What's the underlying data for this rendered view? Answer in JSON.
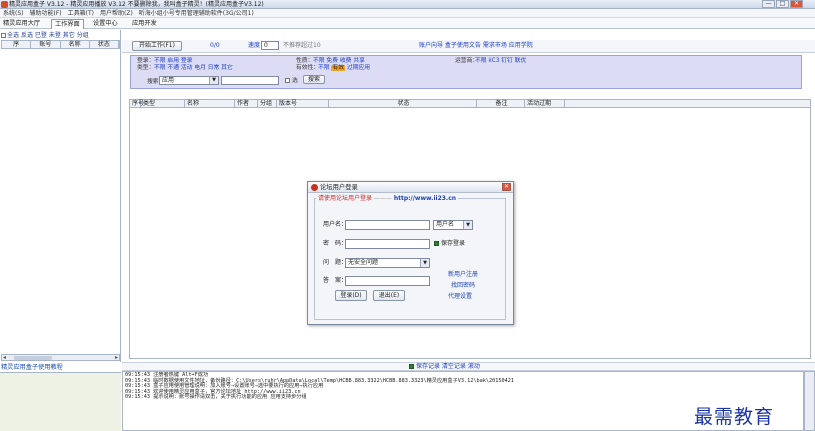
{
  "window": {
    "title": "精灵应用盒子 V3.12 - 精灵应用播放 V3.12 不要删除我，我叫盒子精灵！(精灵应用盒子V3.12)",
    "min": "—",
    "max": "□",
    "close": "✕"
  },
  "menu": [
    "系统(S)",
    "辅助功能(F)",
    "工具箱(T)",
    "用户帮助(Z)",
    "听海小组小号专用管理辅助软件(3G/公司1)"
  ],
  "tabs": [
    "精灵应用大厅",
    "工作界面",
    "设置中心",
    "应用开发"
  ],
  "left": {
    "filter_label": "全选",
    "filter_links": [
      "反选",
      "已登",
      "未登",
      "其它",
      "分组"
    ],
    "columns": [
      "序",
      "账号",
      "名称",
      "状态"
    ],
    "scroll_left": "◂",
    "scroll_right": "▸",
    "help_link": "精灵应用盒子使用教程"
  },
  "toolbar": {
    "start_button": "开始工作(F1)",
    "count": "0/0",
    "speed_label": "速度",
    "speed_value": "0",
    "speed_note": "不推荐超过10",
    "links": "账户向导  盒子使用文告  需求市场  应用学院"
  },
  "filters": {
    "login_label": "登录：",
    "login_opts": "不限  启用  登录",
    "type_label": "类型：",
    "type_opts": "不限  不通  活动  电月  日常  其它",
    "props_label": "性质：",
    "props_opts": "不限  免费  收费  共享",
    "valid_label": "有效性：",
    "valid_pre": "不限",
    "valid_hl": "有效",
    "valid_post": "过期应用",
    "operator_label": "运营商：",
    "operator_opts": "不限  iiC3  钉钉  联优",
    "search_label": "搜索",
    "search_field": "应用",
    "search_value": "",
    "checkbox_label": "选",
    "search_button": "搜索"
  },
  "grid": {
    "columns": [
      "序号",
      "类型",
      "名称",
      "作者",
      "分组",
      "版本号",
      "状态",
      "备注",
      "活动过期"
    ]
  },
  "dialog": {
    "title": "论坛用户登录",
    "group_prefix": "请使用论坛用户登录",
    "group_url": "http://www.ii23.cn",
    "username_label": "用户名：",
    "username_value": "",
    "username_type": "用户名",
    "password_label": "密　码：",
    "password_value": "",
    "save_login": "保存登录",
    "question_label": "问　题：",
    "question_value": "无安全问题",
    "answer_label": "答　案：",
    "answer_value": "",
    "register_link": "新用户注册",
    "recover_link": "找回密码",
    "proxy_link": "代理设置",
    "login_button": "登录(D)",
    "exit_button": "退出(E)",
    "close": "✕"
  },
  "log": {
    "toolbar": "保存记录  清空记录  滚动",
    "lines": [
      "09:15:43 注册者热键 Alt+F成功",
      "09:15:43 临时数据使用文件地址，备份路径：C:\\Users\\ruhr\\AppData\\Local\\Temp\\HCBB.883.3322\\HCBB.883.3323\\精灵应用盒子V3.12\\bak\\20150421",
      "09:15:43 盒子应用使用管理说明：加入账号→设置账号→选中要执行的应用→执行应用",
      "09:15:43 欢迎使用精灵应用盒子，官方论坛地址 http://www.ii23.cn",
      "09:15:43 提示说明：账号操作请双击，关于执行功能的应用 应用支持步分组"
    ]
  },
  "watermark": "最需教育"
}
